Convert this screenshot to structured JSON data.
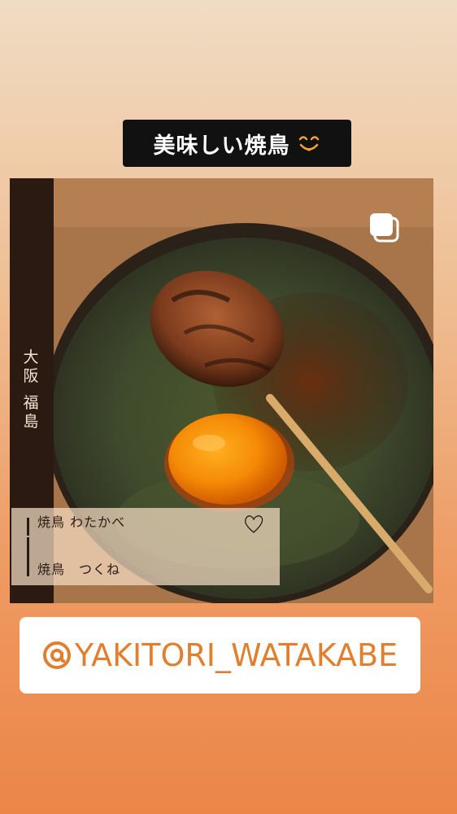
{
  "title_sticker": {
    "text": "美味しい焼鳥",
    "emoji": "smiling-face-icon"
  },
  "photo": {
    "side_label_line1": "大阪",
    "side_label_line2": "福島",
    "caption_line1": "焼鳥 わたかべ",
    "caption_line2": "焼鳥　つくね",
    "icons": [
      "copy-icon",
      "heart-icon"
    ]
  },
  "mention": {
    "text": "YAKITORI_WATAKABE",
    "icon": "at-icon"
  },
  "colors": {
    "accent": "#e27f2e",
    "sticker_bg": "#111111",
    "sidebar": "#2a1a12"
  }
}
